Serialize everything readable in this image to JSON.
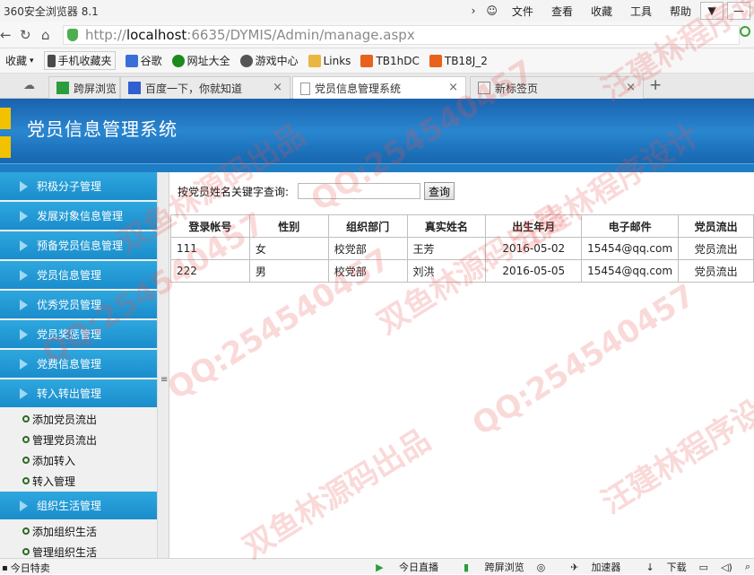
{
  "browser": {
    "window_title": "360安全浏览器 8.1",
    "menu": [
      "文件",
      "查看",
      "收藏",
      "工具",
      "帮助"
    ],
    "url_prefix": "http://",
    "url_host": "localhost",
    "url_rest": ":6635/DYMIS/Admin/manage.aspx",
    "favorites_label": "收藏",
    "bookmarks": [
      {
        "label": "手机收藏夹",
        "icon": "phone-icon",
        "color": "#4a4a4a"
      },
      {
        "label": "谷歌",
        "icon": "google-icon",
        "color": "#3b6fd8"
      },
      {
        "label": "网址大全",
        "icon": "nav-icon",
        "color": "#1c8a1c"
      },
      {
        "label": "游戏中心",
        "icon": "game-icon",
        "color": "#555555"
      },
      {
        "label": "Links",
        "icon": "folder-icon",
        "color": "#e9b640"
      },
      {
        "label": "TB1hDC",
        "icon": "taobao-icon",
        "color": "#e8621b"
      },
      {
        "label": "TB18J_2",
        "icon": "taobao-icon",
        "color": "#e8621b"
      }
    ],
    "tabs": [
      {
        "label": "跨屏浏览",
        "active": false
      },
      {
        "label": "百度一下，你就知道",
        "active": false
      },
      {
        "label": "党员信息管理系统",
        "active": true
      },
      {
        "label": "新标签页",
        "active": false
      }
    ],
    "status_left": "今日特卖",
    "status_right": [
      "今日直播",
      "跨屏浏览",
      "加速器",
      "下载"
    ]
  },
  "app": {
    "title": "党员信息管理系统",
    "sidebar": [
      {
        "type": "menu",
        "label": "积极分子管理"
      },
      {
        "type": "menu",
        "label": "发展对象信息管理"
      },
      {
        "type": "menu",
        "label": "预备党员信息管理"
      },
      {
        "type": "menu",
        "label": "党员信息管理"
      },
      {
        "type": "menu",
        "label": "优秀党员管理"
      },
      {
        "type": "menu",
        "label": "党员奖惩管理"
      },
      {
        "type": "menu",
        "label": "党费信息管理"
      },
      {
        "type": "menu",
        "label": "转入转出管理"
      },
      {
        "type": "sub",
        "label": "添加党员流出"
      },
      {
        "type": "sub",
        "label": "管理党员流出"
      },
      {
        "type": "sub",
        "label": "添加转入"
      },
      {
        "type": "sub",
        "label": "转入管理"
      },
      {
        "type": "menu",
        "label": "组织生活管理"
      },
      {
        "type": "sub",
        "label": "添加组织生活"
      },
      {
        "type": "sub",
        "label": "管理组织生活"
      }
    ],
    "search": {
      "label": "按党员姓名关键字查询:",
      "value": "",
      "button": "查询"
    },
    "table": {
      "columns": [
        "登录帐号",
        "性别",
        "组织部门",
        "真实姓名",
        "出生年月",
        "电子邮件",
        "党员流出"
      ],
      "rows": [
        [
          "111",
          "女",
          "校党部",
          "王芳",
          "2016-05-02",
          "15454@qq.com",
          "党员流出"
        ],
        [
          "222",
          "男",
          "校党部",
          "刘洪",
          "2016-05-05",
          "15454@qq.com",
          "党员流出"
        ]
      ]
    }
  },
  "watermarks": [
    "QQ:254540457",
    "双鱼林源码出品",
    "汪建林程序设计"
  ]
}
